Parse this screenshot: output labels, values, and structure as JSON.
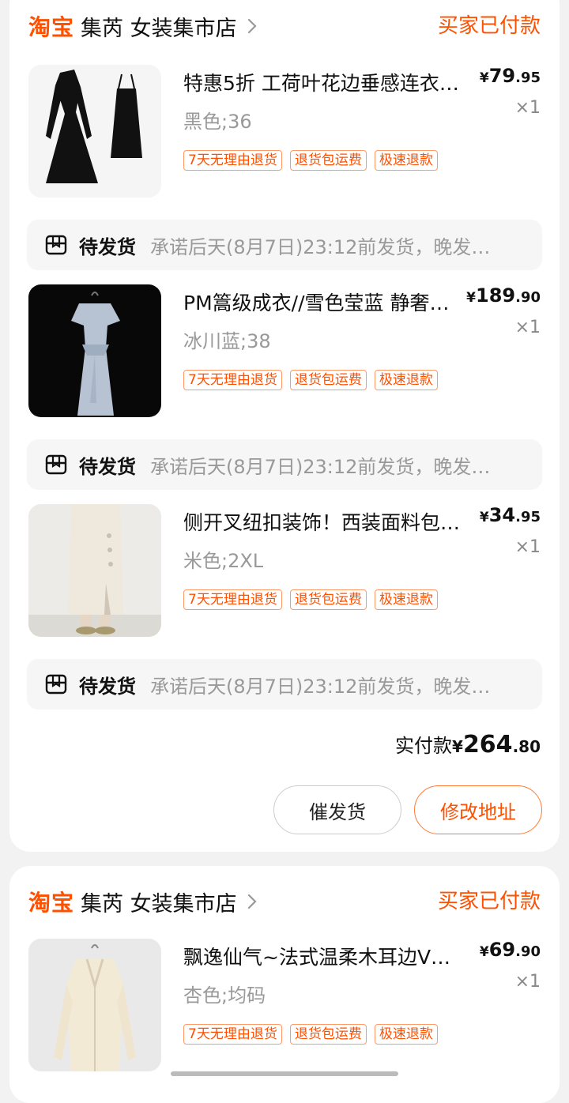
{
  "orders": [
    {
      "logo": "淘宝",
      "shop_name": "集芮 女装集市店",
      "status": "买家已付款",
      "items": [
        {
          "title": "特惠5折 工荷叶花边垂感连衣…",
          "sku": "黑色;36",
          "price": {
            "currency": "¥",
            "int": "79",
            "dec": ".95"
          },
          "qty": "×1",
          "tags": [
            "7天无理由退货",
            "退货包运费",
            "极速退款"
          ],
          "ship_state": "待发货",
          "ship_promise": "承诺后天(8月7日)23:12前发货，晚发…"
        },
        {
          "title": "PM篙级成衣//雪色莹蓝 静奢…",
          "sku": "冰川蓝;38",
          "price": {
            "currency": "¥",
            "int": "189",
            "dec": ".90"
          },
          "qty": "×1",
          "tags": [
            "7天无理由退货",
            "退货包运费",
            "极速退款"
          ],
          "ship_state": "待发货",
          "ship_promise": "承诺后天(8月7日)23:12前发货，晚发…"
        },
        {
          "title": "侧开叉纽扣装饰！西装面料包…",
          "sku": "米色;2XL",
          "price": {
            "currency": "¥",
            "int": "34",
            "dec": ".95"
          },
          "qty": "×1",
          "tags": [
            "7天无理由退货",
            "退货包运费",
            "极速退款"
          ],
          "ship_state": "待发货",
          "ship_promise": "承诺后天(8月7日)23:12前发货，晚发…"
        }
      ],
      "total_label": "实付款",
      "total": {
        "currency": "¥",
        "int": "264",
        "dec": ".80"
      },
      "buttons": {
        "urge": "催发货",
        "change_address": "修改地址"
      }
    },
    {
      "logo": "淘宝",
      "shop_name": "集芮 女装集市店",
      "status": "买家已付款",
      "items": [
        {
          "title": "飘逸仙气~法式温柔木耳边V…",
          "sku": "杏色;均码",
          "price": {
            "currency": "¥",
            "int": "69",
            "dec": ".90"
          },
          "qty": "×1",
          "tags": [
            "7天无理由退货",
            "退货包运费",
            "极速退款"
          ]
        }
      ]
    }
  ],
  "colors": {
    "accent": "#ff5000",
    "page_bg": "#f2f2f2"
  },
  "icons": {
    "shop_arrow": "chevron-right-icon",
    "ship": "package-box-icon"
  }
}
